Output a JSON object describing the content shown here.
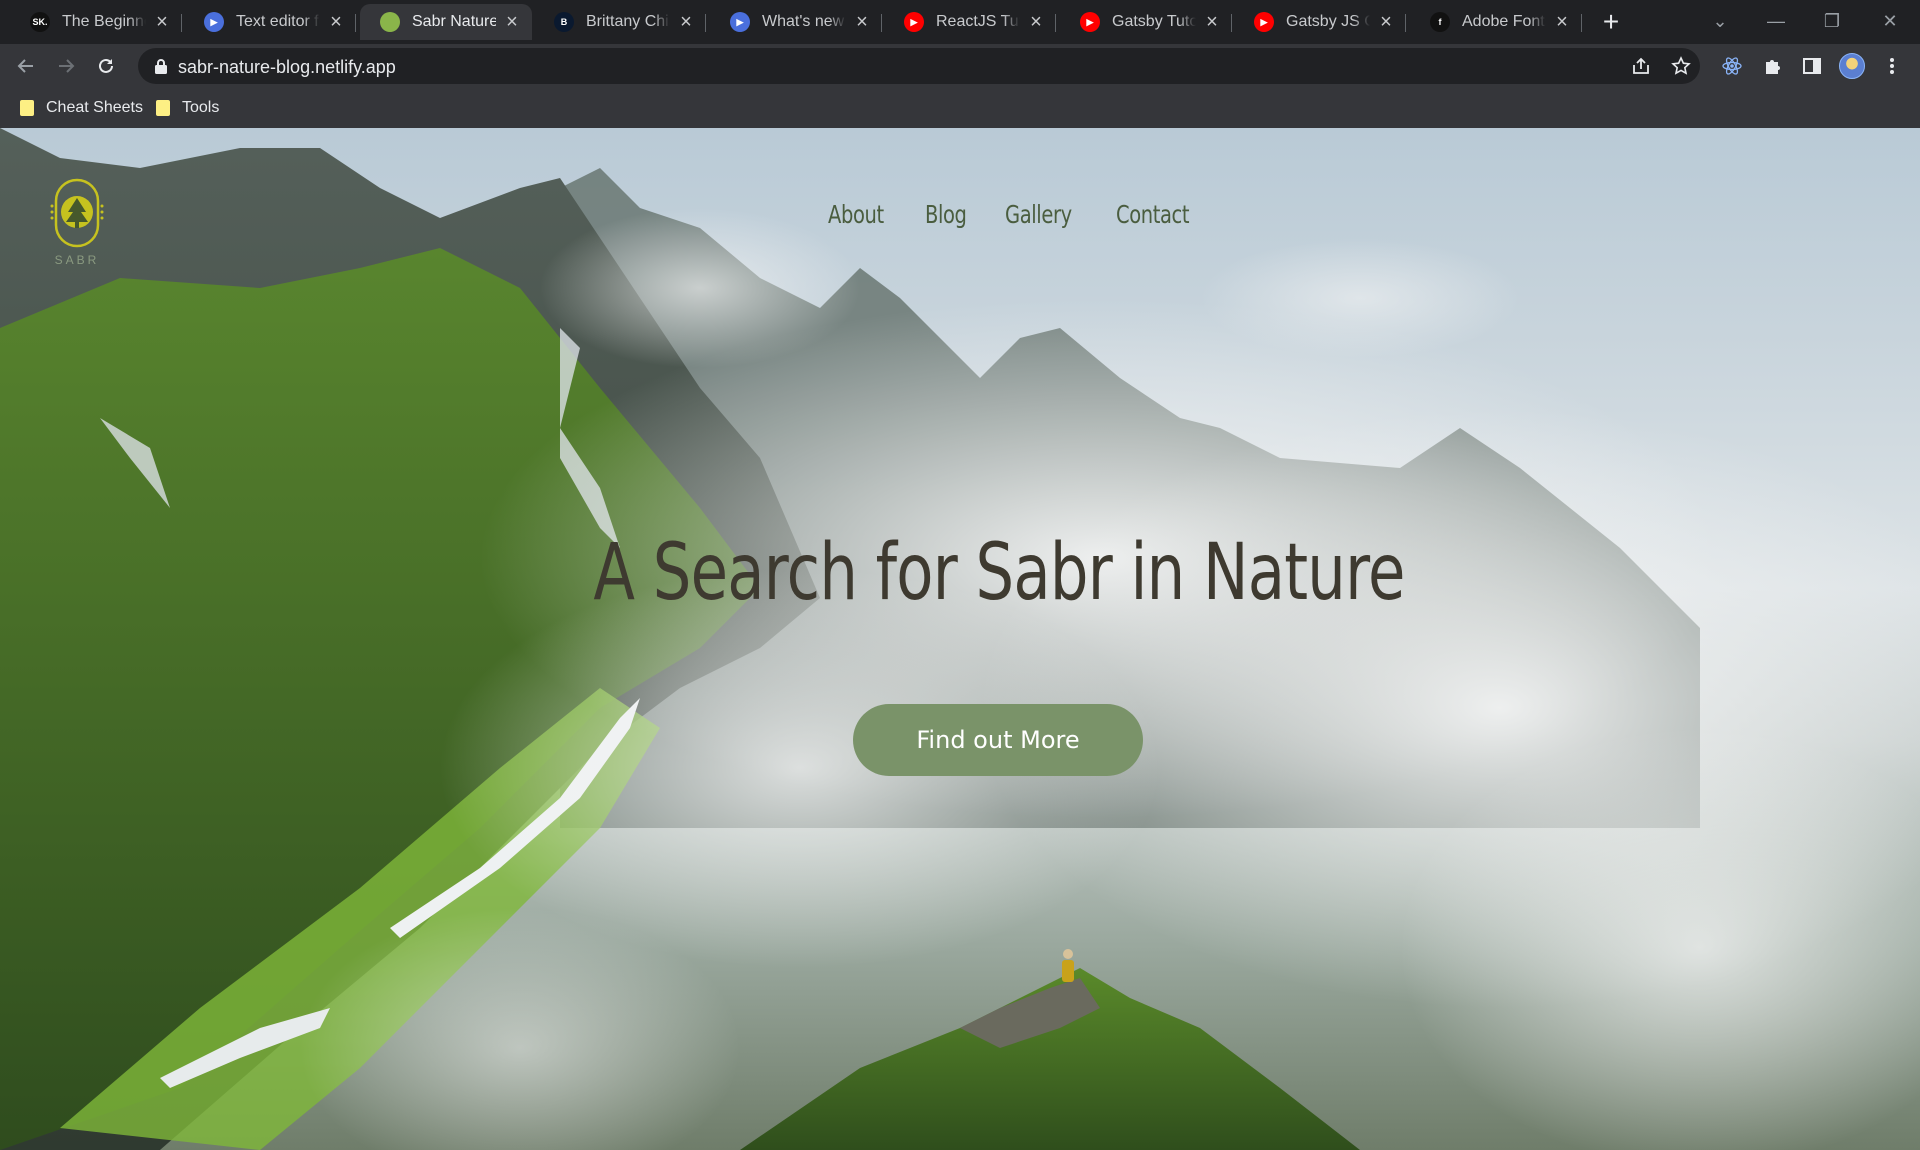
{
  "browser": {
    "tabs": [
      {
        "title": "The Beginner's",
        "favicon_text": "SK.",
        "favicon_color": "#111111",
        "active": false
      },
      {
        "title": "Text editor for",
        "favicon_text": "▶",
        "favicon_color": "#4a6fdc",
        "active": false
      },
      {
        "title": "Sabr Nature",
        "favicon_text": "",
        "favicon_color": "#8ab54a",
        "active": true
      },
      {
        "title": "Brittany Chiang",
        "favicon_text": "B",
        "favicon_color": "#0a192f",
        "active": false
      },
      {
        "title": "What's new in",
        "favicon_text": "▶",
        "favicon_color": "#4a6fdc",
        "active": false
      },
      {
        "title": "ReactJS Tutorial",
        "favicon_text": "▶",
        "favicon_color": "#ff0000",
        "active": false
      },
      {
        "title": "Gatsby Tutorial",
        "favicon_text": "▶",
        "favicon_color": "#ff0000",
        "active": false
      },
      {
        "title": "Gatsby JS Course",
        "favicon_text": "▶",
        "favicon_color": "#ff0000",
        "active": false
      },
      {
        "title": "Adobe Fonts",
        "favicon_text": "f",
        "favicon_color": "#111111",
        "active": false
      }
    ],
    "url": "sabr-nature-blog.netlify.app",
    "bookmarks": [
      {
        "label": "Cheat Sheets"
      },
      {
        "label": "Tools"
      }
    ]
  },
  "site": {
    "logo_text": "SABR",
    "nav": [
      "About",
      "Blog",
      "Gallery",
      "Contact"
    ],
    "hero_title": "A Search for Sabr in Nature",
    "cta_label": "Find out More",
    "colors": {
      "nav": "#4a5d3f",
      "title": "#3e3a30",
      "cta_bg": "#7a9369",
      "logo": "#c6c21f"
    }
  }
}
